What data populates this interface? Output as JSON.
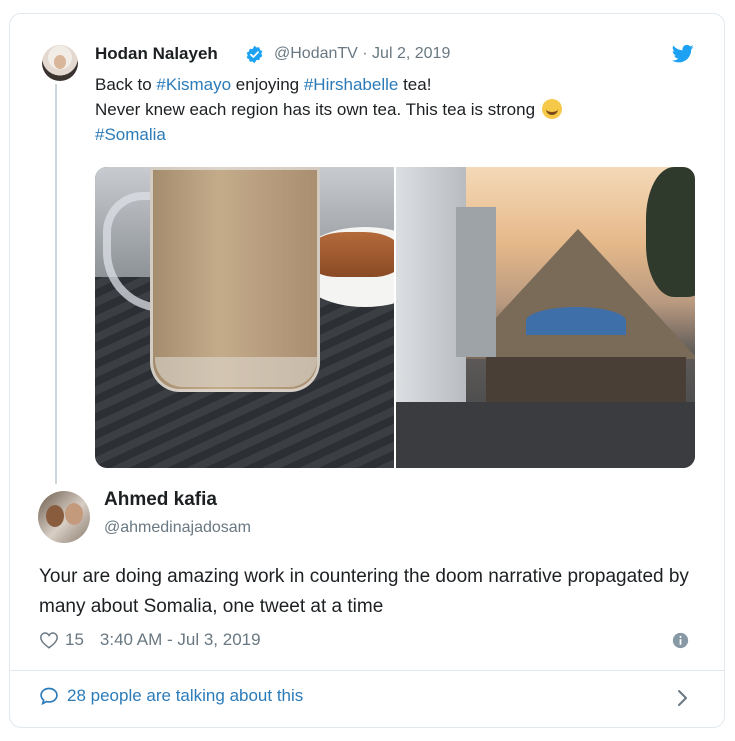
{
  "tweet": {
    "author_name": "Hodan Nalayeh",
    "handle_date": "@HodanTV · Jul 2, 2019",
    "line1_pre": "Back to ",
    "line1_tag1": "#Kismayo",
    "line1_mid": " enjoying ",
    "line1_tag2": "#Hirshabelle",
    "line1_post": " tea!",
    "line2": "Never knew each region has its own tea. This tea is strong ",
    "line3_tag": "#Somalia",
    "icons": {
      "verified": "verified-badge-icon",
      "bird": "twitter-bird-icon",
      "emoji": "tears-of-joy-emoji"
    },
    "accent_color": "#2b7bb9"
  },
  "reply": {
    "author_name": "Ahmed kafia",
    "handle": "@ahmedinajadosam",
    "text": "Your are doing amazing work in countering the doom narrative propagated by many about Somalia,  one tweet at a time",
    "likes": "15",
    "timestamp": "3:40 AM - Jul 3, 2019"
  },
  "footer": {
    "talking": "28 people are talking about this"
  }
}
